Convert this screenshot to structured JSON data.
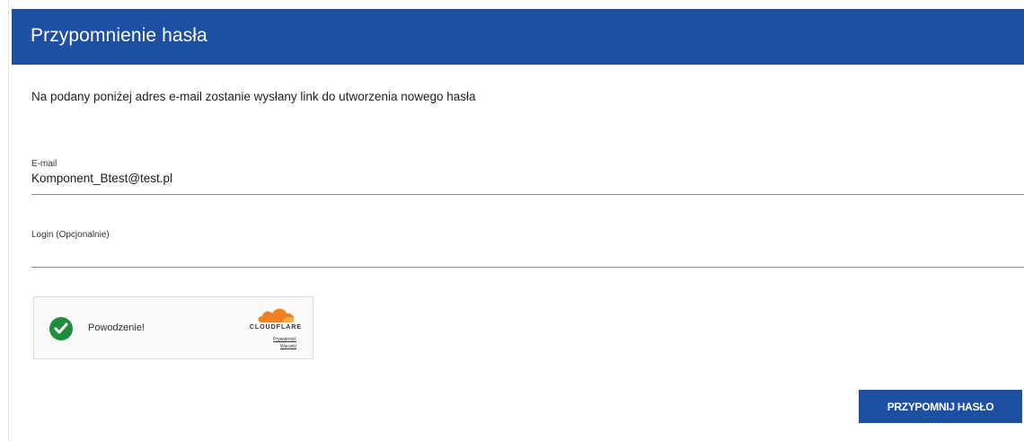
{
  "header": {
    "title": "Przypomnienie hasła"
  },
  "intro": {
    "text": "Na podany poniżej adres e-mail zostanie wysłany link do utworzenia nowego hasła"
  },
  "form": {
    "email": {
      "label": "E-mail",
      "value": "Komponent_Btest@test.pl"
    },
    "login": {
      "label": "Login (Opcjonalnie)",
      "value": ""
    }
  },
  "captcha": {
    "status_text": "Powodzenie!",
    "status_icon": "check-icon",
    "status_color": "#1e8e3e",
    "brand_word": "CLOUDFLARE",
    "privacy_link": "Prywatność",
    "terms_link": "Warunki",
    "brand_color": "#f38020"
  },
  "actions": {
    "submit_label": "PRZYPOMNIJ HASŁO"
  },
  "theme": {
    "primary": "#1d4fa3"
  }
}
